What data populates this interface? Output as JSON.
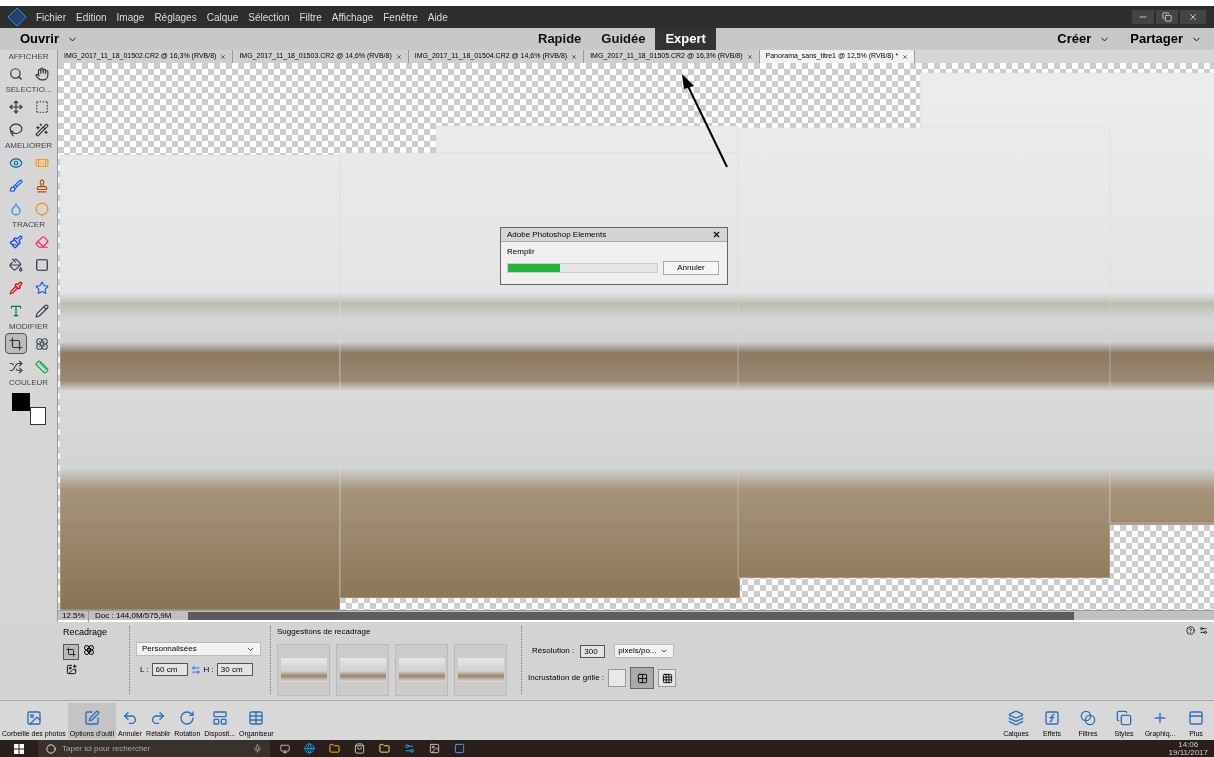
{
  "menu": [
    "Fichier",
    "Edition",
    "Image",
    "Réglages",
    "Calque",
    "Sélection",
    "Filtre",
    "Affichage",
    "Fenêtre",
    "Aide"
  ],
  "mode_bar": {
    "open": "Ouvrir",
    "modes": [
      {
        "label": "Rapide",
        "selected": false
      },
      {
        "label": "Guidée",
        "selected": false
      },
      {
        "label": "Expert",
        "selected": true
      }
    ],
    "actions": [
      "Créer",
      "Partager"
    ]
  },
  "doc_tabs": [
    {
      "label": "IMG_2017_11_18_01502.CR2 @ 16,3% (RVB/8)",
      "selected": false
    },
    {
      "label": "IMG_2017_11_18_01503.CR2 @ 14,6% (RVB/8)",
      "selected": false
    },
    {
      "label": "IMG_2017_11_18_01504.CR2 @ 14,6% (RVB/8)",
      "selected": false
    },
    {
      "label": "IMG_2017_11_18_01505.CR2 @ 16,3% (RVB/8)",
      "selected": false
    },
    {
      "label": "Panorama_sans_titre1 @ 12,5% (RVB/8) *",
      "selected": true
    }
  ],
  "toolbox": [
    {
      "title": "AFFICHER",
      "tools": [
        {
          "kind": "zoom",
          "selected": false
        },
        {
          "kind": "hand",
          "selected": false
        }
      ]
    },
    {
      "title": "SELECTIO...",
      "tools": [
        {
          "kind": "move",
          "selected": false
        },
        {
          "kind": "marquee",
          "selected": false
        },
        {
          "kind": "lasso",
          "selected": false
        },
        {
          "kind": "wand",
          "selected": false
        }
      ]
    },
    {
      "title": "AMELIORER",
      "tools": [
        {
          "kind": "eye",
          "selected": false
        },
        {
          "kind": "healing",
          "selected": false
        },
        {
          "kind": "brush",
          "selected": false
        },
        {
          "kind": "stamp",
          "selected": false
        },
        {
          "kind": "drop",
          "selected": false
        },
        {
          "kind": "sponge",
          "selected": false
        }
      ]
    },
    {
      "title": "TRACER",
      "tools": [
        {
          "kind": "paintbrush",
          "selected": false
        },
        {
          "kind": "eraser",
          "selected": false
        },
        {
          "kind": "bucket",
          "selected": false
        },
        {
          "kind": "gradient",
          "selected": false
        },
        {
          "kind": "pipette",
          "selected": false
        },
        {
          "kind": "shape",
          "selected": false
        },
        {
          "kind": "text",
          "selected": false
        },
        {
          "kind": "pencil",
          "selected": false
        }
      ]
    },
    {
      "title": "MODIFIER",
      "tools": [
        {
          "kind": "crop",
          "selected": true
        },
        {
          "kind": "cookie",
          "selected": false
        },
        {
          "kind": "recompose",
          "selected": false
        },
        {
          "kind": "level",
          "selected": false
        }
      ]
    },
    {
      "title": "COULEUR"
    }
  ],
  "status": {
    "zoom": "12.5%",
    "doc": "Doc : 144,0M/575,9M"
  },
  "dialog": {
    "title": "Adobe Photoshop Elements",
    "task": "Remplir",
    "level": 0.35,
    "button": "Annuler"
  },
  "options": {
    "title": "Recadrage",
    "preset": "Personnalisées",
    "width_label": "L :",
    "width": "60 cm",
    "height_label": "H :",
    "height": "30 cm",
    "suggestions_title": "Suggestions de recadrage",
    "resolution_label": "Résolution :",
    "resolution": "300",
    "unit": "pixels/po...",
    "grid_label": "Incrustation de grille :",
    "grid": [
      {
        "selected": false
      },
      {
        "selected": true
      },
      {
        "selected": false
      }
    ]
  },
  "bottom_left": [
    {
      "kind": "photos",
      "label": "Corbeille des photos",
      "selected": false
    },
    {
      "kind": "tooloptions",
      "label": "Options d'outil",
      "selected": true
    },
    {
      "kind": "undo",
      "label": "Annuler",
      "selected": false
    },
    {
      "kind": "redo",
      "label": "Rétablir",
      "selected": false
    },
    {
      "kind": "rotate",
      "label": "Rotation",
      "selected": false
    },
    {
      "kind": "layout",
      "label": "Disposit...",
      "selected": false
    },
    {
      "kind": "organizer",
      "label": "Organiseur",
      "selected": false
    }
  ],
  "bottom_right": [
    {
      "kind": "layers",
      "label": "Calques"
    },
    {
      "kind": "effects",
      "label": "Effets"
    },
    {
      "kind": "filters",
      "label": "Filtres"
    },
    {
      "kind": "styles",
      "label": "Styles"
    },
    {
      "kind": "graphics",
      "label": "Graphiq..."
    },
    {
      "kind": "more",
      "label": "Plus"
    }
  ],
  "taskbar": {
    "search_placeholder": "Taper ici pour rechercher",
    "time": "14:06",
    "date": "19/11/2017"
  }
}
